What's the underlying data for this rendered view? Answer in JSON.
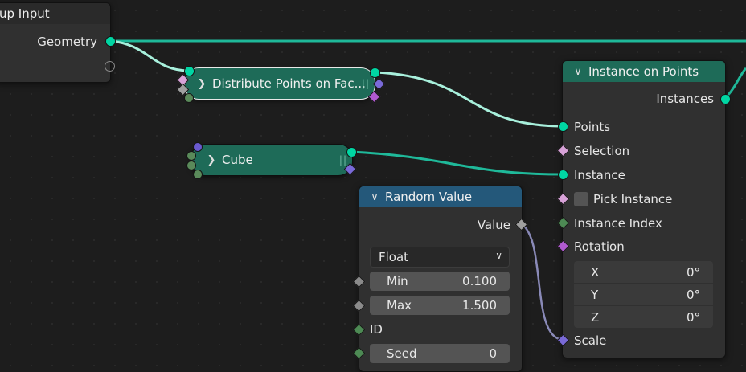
{
  "group_input": {
    "title": "up Input",
    "output_label": "Geometry"
  },
  "distribute": {
    "title": "Distribute Points on Fac..."
  },
  "cube": {
    "title": "Cube"
  },
  "instance_on_points": {
    "title": "Instance on Points",
    "output_label": "Instances",
    "inputs": {
      "points": "Points",
      "selection": "Selection",
      "instance": "Instance",
      "pick_instance": "Pick Instance",
      "instance_index": "Instance Index",
      "rotation": "Rotation",
      "scale": "Scale"
    },
    "rotation_fields": [
      {
        "label": "X",
        "value": "0°"
      },
      {
        "label": "Y",
        "value": "0°"
      },
      {
        "label": "Z",
        "value": "0°"
      }
    ]
  },
  "random_value": {
    "title": "Random Value",
    "output_label": "Value",
    "data_type": "Float",
    "min": {
      "label": "Min",
      "value": "0.100"
    },
    "max": {
      "label": "Max",
      "value": "1.500"
    },
    "id_label": "ID",
    "seed": {
      "label": "Seed",
      "value": "0"
    }
  },
  "colors": {
    "geometry_socket": "#00d6a3",
    "geometry_node_header": "#1e6b58",
    "function_node_header": "#24587a",
    "wire": "#1fb99a",
    "selected_wire": "#a8f0dc"
  }
}
